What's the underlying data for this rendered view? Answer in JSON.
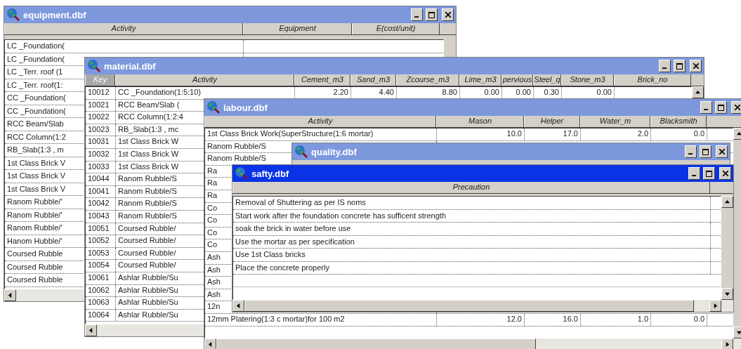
{
  "windows": [
    {
      "title": "equipment.dbf",
      "active": false,
      "columns": [
        {
          "label": "Activity",
          "numeric": false,
          "selected": false
        },
        {
          "label": "Equipment",
          "selected": false
        },
        {
          "label": "E(cost/unit)",
          "selected": false
        }
      ],
      "rows": [
        [
          "LC _Foundation("
        ],
        [
          "LC _Foundation("
        ],
        [
          "LC _Terr. roof (1"
        ],
        [
          "LC _Terr. roof(1:"
        ],
        [
          "CC _Foundation("
        ],
        [
          "CC _Foundation("
        ],
        [
          "RCC Beam/Slab"
        ],
        [
          "RCC Column(1:2"
        ],
        [
          "RB_Slab(1:3 , m"
        ],
        [
          "1st Class Brick V"
        ],
        [
          "1st Class Brick V"
        ],
        [
          "1st Class Brick V"
        ],
        [
          "Ranom Rubble/'"
        ],
        [
          "Ranom Rubble/'"
        ],
        [
          "Ranom Rubble/'"
        ],
        [
          "Hanom Hubble/'"
        ],
        [
          "Coursed Rubble"
        ],
        [
          "Coursed Rubble"
        ],
        [
          "Coursed Rubble"
        ]
      ]
    },
    {
      "title": "material.dbf",
      "active": false,
      "columns": [
        {
          "label": "Key",
          "numeric": false,
          "selected": true
        },
        {
          "label": "Activity",
          "numeric": false,
          "selected": false
        },
        {
          "label": "Cement_m3",
          "numeric": true,
          "selected": false
        },
        {
          "label": "Sand_m3",
          "numeric": true,
          "selected": false
        },
        {
          "label": "Zcourse_m3",
          "numeric": true,
          "selected": false
        },
        {
          "label": "Lime_m3",
          "numeric": true,
          "selected": false
        },
        {
          "label": "pervious",
          "numeric": true,
          "selected": false
        },
        {
          "label": "Steel_q",
          "numeric": true,
          "selected": false
        },
        {
          "label": "Stone_m3",
          "numeric": true,
          "selected": false
        },
        {
          "label": "Brick_no",
          "selected": false
        }
      ],
      "rows": [
        [
          "10012",
          "CC _Foundation(1:5:10)",
          "2.20",
          "4.40",
          "8.80",
          "0.00",
          "0.00",
          "0.30",
          "0.00"
        ],
        [
          "10021",
          "RCC Beam/Slab ("
        ],
        [
          "10022",
          "RCC Column(1:2:4"
        ],
        [
          "10023",
          "RB_Slab(1:3 , mc"
        ],
        [
          "10031",
          "1st Class Brick W"
        ],
        [
          "10032",
          "1st Class Brick W"
        ],
        [
          "10033",
          "1st Class Brick W"
        ],
        [
          "10044",
          "Ranom Rubble/S"
        ],
        [
          "10041",
          "Ranom Rubble/S"
        ],
        [
          "10042",
          "Ranom Rubble/S"
        ],
        [
          "10043",
          "Ranom Rubble/S"
        ],
        [
          "10051",
          "Coursed Rubble/"
        ],
        [
          "10052",
          "Coursed Rubble/"
        ],
        [
          "10053",
          "Coursed Rubble/"
        ],
        [
          "10054",
          "Coursed Rubble/"
        ],
        [
          "10061",
          "Ashlar Rubble/Su"
        ],
        [
          "10062",
          "Ashlar Rubble/Su"
        ],
        [
          "10063",
          "Ashlar Rubble/Su"
        ],
        [
          "10064",
          "Ashlar Rubble/Su"
        ]
      ]
    },
    {
      "title": "labour.dbf",
      "active": false,
      "columns": [
        {
          "label": "Activity",
          "numeric": false,
          "selected": false
        },
        {
          "label": "Mason",
          "numeric": true,
          "selected": false
        },
        {
          "label": "Helper",
          "numeric": true,
          "selected": false
        },
        {
          "label": "Water_m",
          "numeric": true,
          "selected": false
        },
        {
          "label": "Blacksmith",
          "numeric": true,
          "selected": false
        }
      ],
      "rows": [
        [
          "1st Class Brick Work(SuperStructure(1:6 mortar)",
          "10.0",
          "17.0",
          "2.0",
          "0.0"
        ],
        [
          "Ranom Rubble/S"
        ],
        [
          "Ranom Rubble/S"
        ],
        [
          "Ra"
        ],
        [
          "Ra"
        ],
        [
          "Ra"
        ],
        [
          "Co"
        ],
        [
          "Co"
        ],
        [
          "Co"
        ],
        [
          "Co"
        ],
        [
          "Ash"
        ],
        [
          "Ash"
        ],
        [
          "Ash"
        ],
        [
          "Ash"
        ],
        [
          "12n"
        ],
        [
          "12mm Platering(1:3 c mortar)for 100 m2",
          "12.0",
          "16.0",
          "1.0",
          "0.0"
        ]
      ]
    },
    {
      "title": "quality.dbf",
      "active": false
    },
    {
      "title": "safty.dbf",
      "active": true,
      "columns": [
        {
          "label": "Precaution",
          "numeric": false,
          "selected": false
        }
      ],
      "rows": [
        [
          "Removal  of Shuttering as per IS noms"
        ],
        [
          "Start work after the foundation concrete has sufficent strength"
        ],
        [
          "soak the brick in water  before use"
        ],
        [
          "Use the mortar as per specification"
        ],
        [
          "Use 1st Class bricks"
        ],
        [
          "Place the concrete properly"
        ]
      ]
    }
  ]
}
